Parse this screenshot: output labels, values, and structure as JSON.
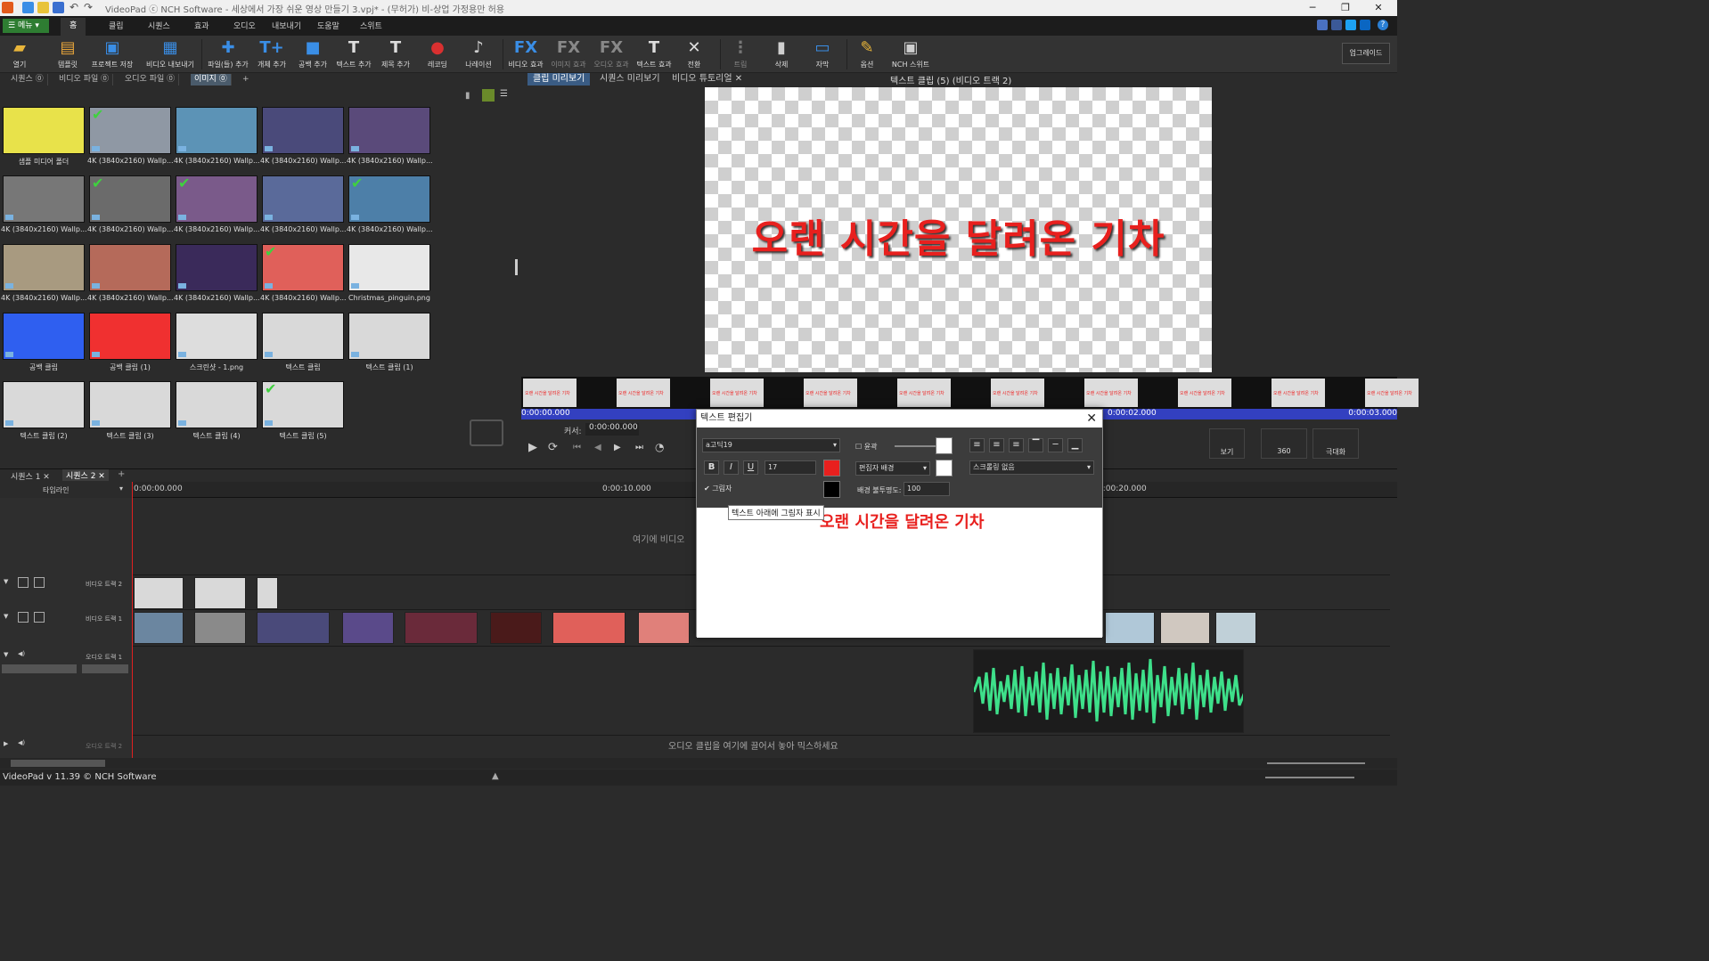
{
  "app": {
    "title": "VideoPad ⓒ NCH Software - 세상에서 가장 쉬운 영상 만들기 3.vpj* - (무허가) 비-상업 가정용만 허용",
    "status": "VideoPad v 11.39 © NCH Software"
  },
  "menu": {
    "menu_button": "메뉴",
    "tabs": [
      "홈",
      "클립",
      "시퀀스",
      "효과",
      "오디오",
      "내보내기",
      "도움말",
      "스위트"
    ]
  },
  "toolbar": {
    "items": [
      {
        "label": "열기",
        "icon": "folder-open-icon"
      },
      {
        "label": "템플릿",
        "icon": "template-icon"
      },
      {
        "label": "프로젝트 저장",
        "icon": "save-icon"
      },
      {
        "label": "비디오 내보내기",
        "icon": "export-video-icon"
      },
      {
        "label": "파일(들) 추가",
        "icon": "add-files-icon"
      },
      {
        "label": "개체 추가",
        "icon": "add-object-icon"
      },
      {
        "label": "공백 추가",
        "icon": "add-blank-icon"
      },
      {
        "label": "텍스트 추가",
        "icon": "add-text-icon"
      },
      {
        "label": "제목 추가",
        "icon": "add-title-icon"
      },
      {
        "label": "레코딩",
        "icon": "record-icon"
      },
      {
        "label": "나레이션",
        "icon": "microphone-icon"
      },
      {
        "label": "비디오 효과",
        "icon": "video-fx-icon"
      },
      {
        "label": "이미지 효과",
        "icon": "image-fx-icon"
      },
      {
        "label": "오디오 효과",
        "icon": "audio-fx-icon"
      },
      {
        "label": "텍스트 효과",
        "icon": "text-fx-icon"
      },
      {
        "label": "전환",
        "icon": "transition-icon"
      },
      {
        "label": "트림",
        "icon": "trim-icon"
      },
      {
        "label": "삭제",
        "icon": "delete-icon"
      },
      {
        "label": "자막",
        "icon": "subtitle-icon"
      },
      {
        "label": "옵션",
        "icon": "options-icon"
      },
      {
        "label": "NCH 스위트",
        "icon": "nch-suite-icon"
      }
    ],
    "upgrade": "업그레이드"
  },
  "bin_tabs": [
    "시퀀스",
    "비디오 파일",
    "오디오 파일",
    "이미지"
  ],
  "bin_items": [
    {
      "label": "샘플 미디어 폴더",
      "color": "#e8e24a",
      "checked": false
    },
    {
      "label": "4K (3840x2160) Wallp...",
      "color": "#8f98a4",
      "checked": true
    },
    {
      "label": "4K (3840x2160) Wallp...",
      "color": "#5c93b6",
      "checked": false
    },
    {
      "label": "4K (3840x2160) Wallp...",
      "color": "#4a4a7a",
      "checked": false
    },
    {
      "label": "4K (3840x2160) Wallp...",
      "color": "#5a4a7a",
      "checked": false
    },
    {
      "label": "4K (3840x2160) Wallp...",
      "color": "#777777",
      "checked": false
    },
    {
      "label": "4K (3840x2160) Wallp...",
      "color": "#6b6b6b",
      "checked": true
    },
    {
      "label": "4K (3840x2160) Wallp...",
      "color": "#7a5a8a",
      "checked": true
    },
    {
      "label": "4K (3840x2160) Wallp...",
      "color": "#5a6a9a",
      "checked": false
    },
    {
      "label": "4K (3840x2160) Wallp...",
      "color": "#4d7fa8",
      "checked": true
    },
    {
      "label": "4K (3840x2160) Wallp...",
      "color": "#a89a80",
      "checked": false
    },
    {
      "label": "4K (3840x2160) Wallp...",
      "color": "#b56a5a",
      "checked": false
    },
    {
      "label": "4K (3840x2160) Wallp...",
      "color": "#3a2a5a",
      "checked": false
    },
    {
      "label": "4K (3840x2160) Wallp...",
      "color": "#e0605a",
      "checked": true
    },
    {
      "label": "Christmas_pinguin.png",
      "color": "#e8e8e8",
      "checked": false
    },
    {
      "label": "공백 클립",
      "color": "#2f5ff0",
      "checked": false
    },
    {
      "label": "공백 클립 (1)",
      "color": "#f03030",
      "checked": false
    },
    {
      "label": "스크린샷 - 1.png",
      "color": "#dddddd",
      "checked": false
    },
    {
      "label": "텍스트 클립",
      "color": "#d9d9d9",
      "checked": false
    },
    {
      "label": "텍스트 클립 (1)",
      "color": "#d9d9d9",
      "checked": false
    },
    {
      "label": "텍스트 클립 (2)",
      "color": "#d9d9d9",
      "checked": false
    },
    {
      "label": "텍스트 클립 (3)",
      "color": "#d9d9d9",
      "checked": false
    },
    {
      "label": "텍스트 클립 (4)",
      "color": "#d9d9d9",
      "checked": false
    },
    {
      "label": "텍스트 클립 (5)",
      "color": "#d9d9d9",
      "checked": true
    }
  ],
  "preview": {
    "tabs": [
      "클립 미리보기",
      "시퀀스 미리보기",
      "비디오 튜토리얼"
    ],
    "title": "텍스트 클립 (5) (비디오 트랙 2)",
    "canvas_text": "오랜 시간을 달려온 기차",
    "frame_text": "오랜 시간을 달려온 기차",
    "time_start": "0:00:00.000",
    "time_mid": "0:00:02.000",
    "time_end": "0:00:03.000",
    "cursor_label": "커서:",
    "cursor_value": "0:00:00.000",
    "view_label": "보기",
    "maximize_label": "극대화",
    "vr_label": "360"
  },
  "text_editor": {
    "title": "텍스트 편집기",
    "font": "a고딕19",
    "size": "17",
    "outline_label": "윤곽",
    "shadow_label": "그림자",
    "shadow_checked": true,
    "background_label": "편집자 배경",
    "bg_opacity_label": "배경 불투명도:",
    "bg_opacity_value": "100",
    "scroll": "스크롤링 없음",
    "tooltip": "텍스트 아래에 그림자 표시",
    "body_text": "오랜 시간을 달려온 기차",
    "text_color": "#e8201e"
  },
  "timeline": {
    "seq_tabs": [
      "시퀀스 1",
      "시퀀스 2"
    ],
    "mode": "타임라인",
    "ruler": [
      "0:00:00.000",
      "0:00:10.000",
      "0:00:20.000"
    ],
    "drop_video_hint": "여기에 비디오",
    "tracks": [
      "비디오 트랙 2",
      "비디오 트랙 1",
      "오디오 트랙 1",
      "오디오 트랙 2"
    ],
    "drop_audio_hint": "오디오 클립을 여기에 끌어서 놓아 믹스하세요"
  }
}
